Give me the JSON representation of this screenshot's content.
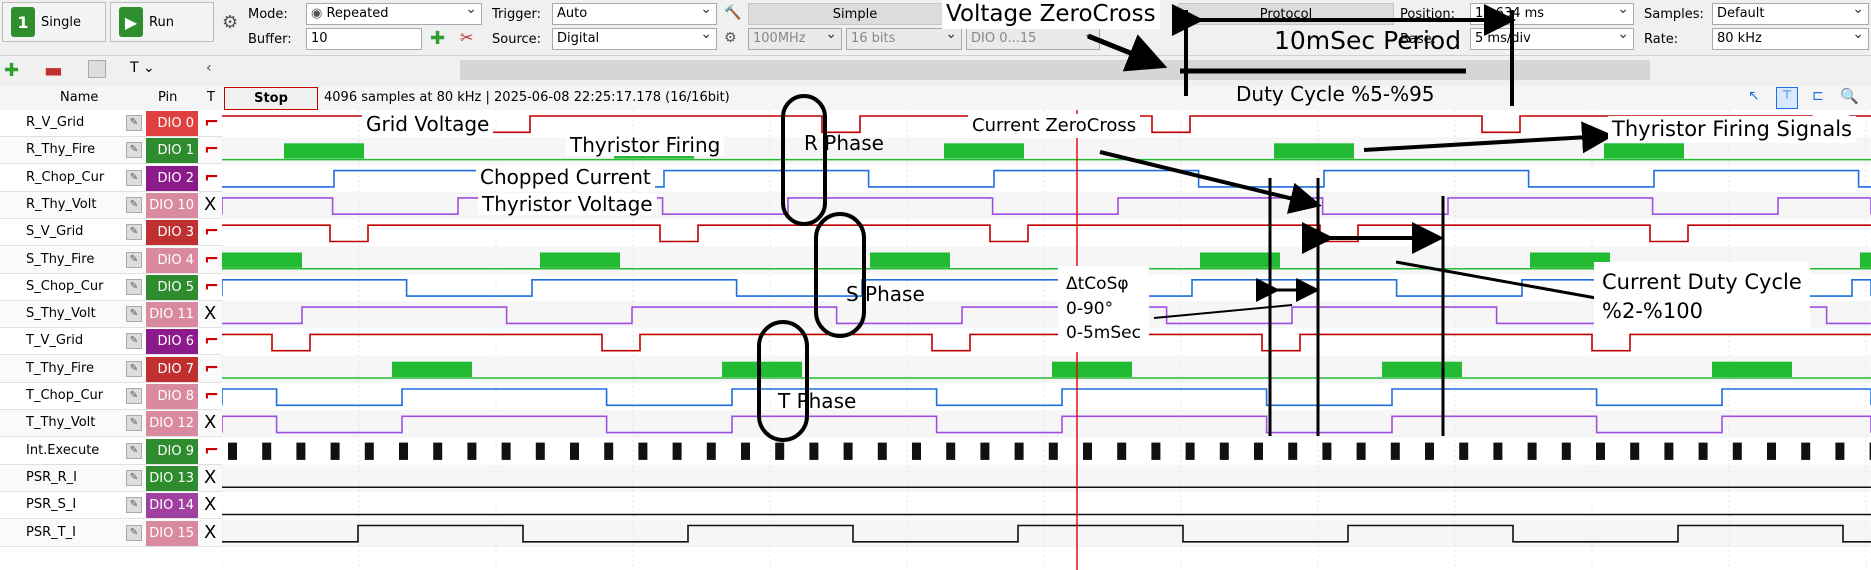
{
  "toolbar": {
    "single_label": "Single",
    "run_label": "Run",
    "mode_label": "Mode:",
    "mode_value": "Repeated",
    "buffer_label": "Buffer:",
    "buffer_value": "10",
    "trigger_label": "Trigger:",
    "trigger_value": "Auto",
    "source_label": "Source:",
    "source_value": "Digital",
    "simple_label": "Simple",
    "rate_disabled": "100MHz",
    "bits_disabled": "16 bits",
    "dio_disabled": "DIO 0...15",
    "protocol_label": "Protocol",
    "position_label": "Position:",
    "position_value": "10.634 ms",
    "base_label": "Base:",
    "base_value": "5 ms/div",
    "samples_label": "Samples:",
    "samples_value": "Default",
    "rate_label": "Rate:",
    "rate_value": "80 kHz"
  },
  "channel_header": {
    "name": "Name",
    "pin": "Pin",
    "t": "T"
  },
  "status": {
    "stop_label": "Stop",
    "info": "4096 samples at 80 kHz | 2025-06-08 22:25:17.178 (16/16bit)"
  },
  "channels": [
    {
      "name": "R_V_Grid",
      "pin": "DIO 0",
      "trigger": "edge",
      "color": "#e04040"
    },
    {
      "name": "R_Thy_Fire",
      "pin": "DIO 1",
      "trigger": "edge",
      "color": "#2e8b2e"
    },
    {
      "name": "R_Chop_Cur",
      "pin": "DIO 2",
      "trigger": "edge",
      "color": "#8b1a8b"
    },
    {
      "name": "R_Thy_Volt",
      "pin": "DIO 10",
      "trigger": "X",
      "color": "#d98aa0"
    },
    {
      "name": "S_V_Grid",
      "pin": "DIO 3",
      "trigger": "edge",
      "color": "#c03030"
    },
    {
      "name": "S_Thy_Fire",
      "pin": "DIO 4",
      "trigger": "edge",
      "color": "#d98aa0"
    },
    {
      "name": "S_Chop_Cur",
      "pin": "DIO 5",
      "trigger": "edge",
      "color": "#2e8b2e"
    },
    {
      "name": "S_Thy_Volt",
      "pin": "DIO 11",
      "trigger": "X",
      "color": "#d98aa0"
    },
    {
      "name": "T_V_Grid",
      "pin": "DIO 6",
      "trigger": "edge",
      "color": "#8b1a8b"
    },
    {
      "name": "T_Thy_Fire",
      "pin": "DIO 7",
      "trigger": "edge",
      "color": "#c03030"
    },
    {
      "name": "T_Chop_Cur",
      "pin": "DIO 8",
      "trigger": "edge",
      "color": "#d98aa0"
    },
    {
      "name": "T_Thy_Volt",
      "pin": "DIO 12",
      "trigger": "X",
      "color": "#d98aa0"
    },
    {
      "name": "Int.Execute",
      "pin": "DIO 9",
      "trigger": "edge",
      "color": "#2e8b2e"
    },
    {
      "name": "PSR_R_I",
      "pin": "DIO 13",
      "trigger": "X",
      "color": "#2e8b2e"
    },
    {
      "name": "PSR_S_I",
      "pin": "DIO 14",
      "trigger": "X",
      "color": "#a040a0"
    },
    {
      "name": "PSR_T_I",
      "pin": "DIO 15",
      "trigger": "X",
      "color": "#d98aa0"
    }
  ],
  "annotations": {
    "voltage_zerocross": "Voltage ZeroCross",
    "period": "10mSec Period",
    "duty_cycle": "Duty Cycle %5-%95",
    "grid_voltage": "Grid Voltage",
    "thyristor_firing": "Thyristor Firing",
    "r_phase": "R  Phase",
    "current_zerocross": "Current ZeroCross",
    "thyristor_firing_signals": "Thyristor Firing Signals",
    "chopped_current": "Chopped Current",
    "thyristor_voltage": "Thyristor Voltage",
    "s_phase": "S  Phase",
    "t_phase": "T   Phase",
    "delta_line1": "ΔtCoSφ",
    "delta_line2": "0-90°",
    "delta_line3": "0-5mSec",
    "current_duty_line1": "Current Duty Cycle",
    "current_duty_line2": "%2-%100"
  },
  "colors": {
    "grid_wave": "#c00000",
    "fire_pulse": "#22bb33",
    "chop_wave": "#1f6fe0",
    "volt_wave": "#a050e0",
    "cursor": "#e00000"
  }
}
